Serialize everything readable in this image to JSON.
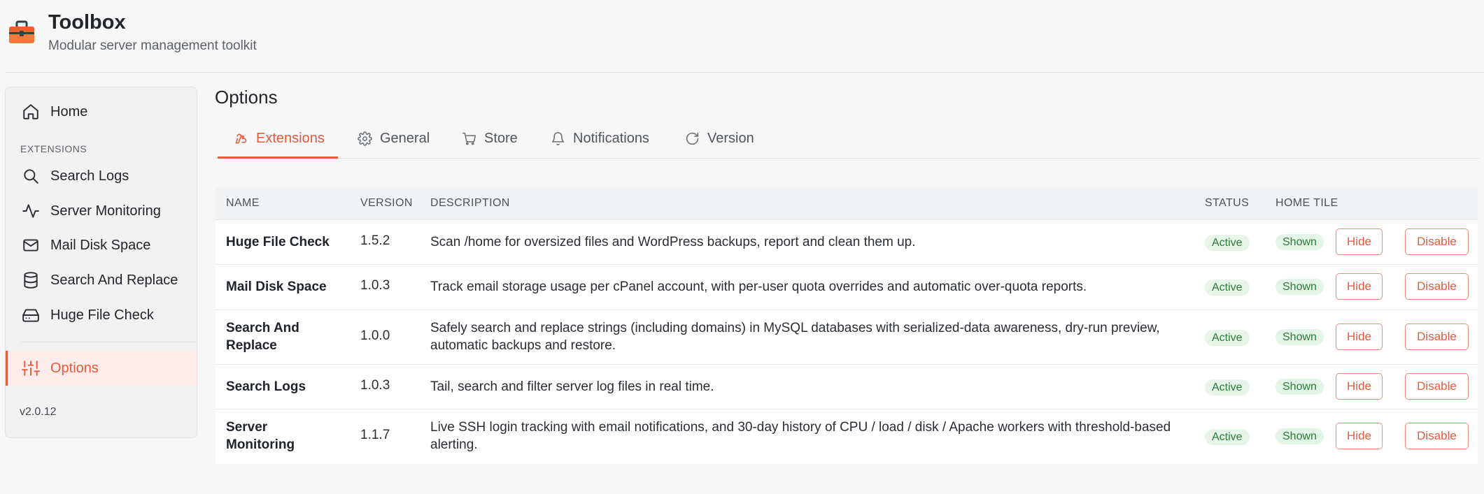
{
  "app": {
    "title": "Toolbox",
    "subtitle": "Modular server management toolkit",
    "version": "v2.0.12"
  },
  "sidebar": {
    "home": "Home",
    "section_label": "EXTENSIONS",
    "items": [
      {
        "label": "Search Logs",
        "icon": "search-icon"
      },
      {
        "label": "Server Monitoring",
        "icon": "activity-icon"
      },
      {
        "label": "Mail Disk Space",
        "icon": "mail-icon"
      },
      {
        "label": "Search And Replace",
        "icon": "database-icon"
      },
      {
        "label": "Huge File Check",
        "icon": "hard-drive-icon"
      }
    ],
    "options": "Options"
  },
  "page": {
    "title": "Options",
    "tabs": [
      {
        "label": "Extensions",
        "icon": "puzzle-icon",
        "active": true
      },
      {
        "label": "General",
        "icon": "gear-icon"
      },
      {
        "label": "Store",
        "icon": "cart-icon"
      },
      {
        "label": "Notifications",
        "icon": "bell-icon"
      },
      {
        "label": "Version",
        "icon": "refresh-icon"
      }
    ]
  },
  "table": {
    "headers": {
      "name": "NAME",
      "version": "VERSION",
      "description": "DESCRIPTION",
      "status": "STATUS",
      "home_tile": "HOME TILE"
    },
    "rows": [
      {
        "name": "Huge File Check",
        "version": "1.5.2",
        "description": "Scan /home for oversized files and WordPress backups, report and clean them up.",
        "status": "Active",
        "tile": "Shown",
        "hide": "Hide",
        "disable": "Disable"
      },
      {
        "name": "Mail Disk Space",
        "version": "1.0.3",
        "description": "Track email storage usage per cPanel account, with per-user quota overrides and automatic over-quota reports.",
        "status": "Active",
        "tile": "Shown",
        "hide": "Hide",
        "disable": "Disable"
      },
      {
        "name": "Search And Replace",
        "version": "1.0.0",
        "description": "Safely search and replace strings (including domains) in MySQL databases with serialized-data awareness, dry-run preview, automatic backups and restore.",
        "status": "Active",
        "tile": "Shown",
        "hide": "Hide",
        "disable": "Disable"
      },
      {
        "name": "Search Logs",
        "version": "1.0.3",
        "description": "Tail, search and filter server log files in real time.",
        "status": "Active",
        "tile": "Shown",
        "hide": "Hide",
        "disable": "Disable"
      },
      {
        "name": "Server Monitoring",
        "version": "1.1.7",
        "description": "Live SSH login tracking with email notifications, and 30-day history of CPU / load / disk / Apache workers with threshold-based alerting.",
        "status": "Active",
        "tile": "Shown",
        "hide": "Hide",
        "disable": "Disable"
      }
    ]
  },
  "colors": {
    "accent": "#e55a3b",
    "active_badge_bg": "#e6f5e8",
    "active_badge_text": "#2c7a3a"
  }
}
